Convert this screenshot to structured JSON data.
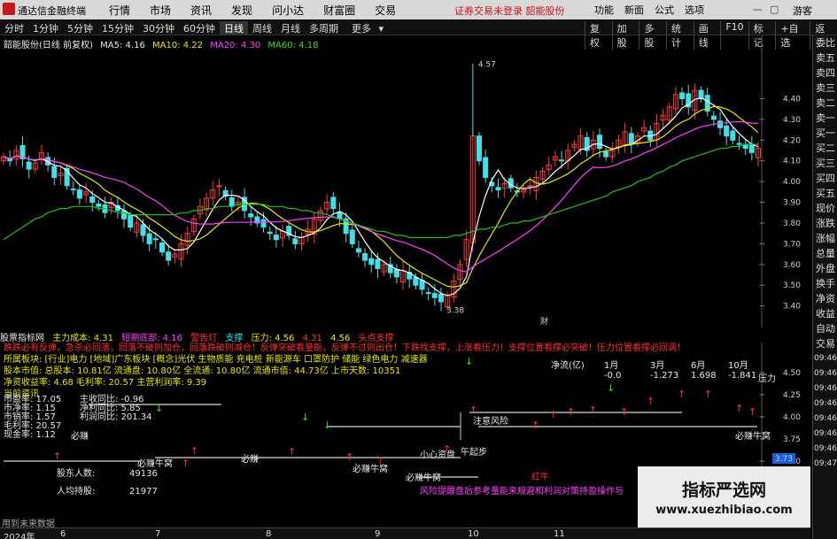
{
  "app": {
    "name": "通达信金融终端",
    "menu": [
      "行情",
      "市场",
      "资讯",
      "发现",
      "问小达",
      "财富圈",
      "交易"
    ],
    "warning": "证券交易未登录",
    "stock_title": "韶能股份",
    "right_menu": [
      "功能",
      "新面",
      "公式",
      "选项"
    ],
    "guest": "游客"
  },
  "toolbar": {
    "timeframes": [
      "分时",
      "1分钟",
      "5分钟",
      "15分钟",
      "30分钟",
      "60分钟",
      "日线",
      "周线",
      "月线",
      "多周期",
      "更多"
    ],
    "selected": "日线",
    "tools": [
      "复权",
      "加股",
      "多股",
      "统计",
      "画线",
      "F10",
      "标记",
      "+自选",
      "返回"
    ]
  },
  "main_legend": {
    "name": "韶能股份(日线 前复权)",
    "ma5": "MA5: 4.16",
    "ma10": "MA10: 4.22",
    "ma20": "MA20: 4.30",
    "ma60": "MA60: 4.18"
  },
  "colors": {
    "up": "#ff3b3b",
    "down": "#40e0e8",
    "ma5": "#ffffff",
    "ma10": "#e8e800",
    "ma20": "#ff40ff",
    "ma60": "#20c020"
  },
  "chart_data": {
    "type": "candlestick",
    "ylim": [
      3.36,
      4.62
    ],
    "y_ticks": [
      "4.40",
      "4.30",
      "4.20",
      "4.10",
      "4.00",
      "3.90",
      "3.80",
      "3.70",
      "3.60",
      "3.50",
      "3.40"
    ],
    "annotations": {
      "high": "4.57",
      "low": "3.38",
      "marker": "财"
    },
    "closes": [
      4.12,
      4.1,
      4.15,
      4.11,
      4.06,
      4.09,
      4.14,
      4.08,
      4.02,
      4.04,
      3.98,
      3.96,
      3.92,
      3.95,
      3.9,
      3.88,
      3.85,
      3.9,
      3.86,
      3.82,
      3.78,
      3.8,
      3.74,
      3.7,
      3.72,
      3.66,
      3.62,
      3.65,
      3.7,
      3.75,
      3.82,
      3.88,
      3.92,
      3.96,
      3.98,
      3.93,
      3.88,
      3.9,
      3.86,
      3.83,
      3.8,
      3.78,
      3.75,
      3.72,
      3.76,
      3.74,
      3.7,
      3.73,
      3.77,
      3.82,
      3.86,
      3.9,
      3.87,
      3.82,
      3.75,
      3.7,
      3.66,
      3.62,
      3.6,
      3.58,
      3.6,
      3.56,
      3.54,
      3.57,
      3.53,
      3.5,
      3.48,
      3.46,
      3.44,
      3.42,
      3.45,
      3.52,
      3.6,
      3.72,
      4.22,
      4.1,
      4.02,
      3.98,
      3.96,
      3.99,
      3.97,
      3.95,
      3.96,
      3.98,
      4.02,
      4.05,
      4.08,
      4.12,
      4.1,
      4.15,
      4.18,
      4.22,
      4.15,
      4.2,
      4.16,
      4.12,
      4.15,
      4.2,
      4.24,
      4.18,
      4.22,
      4.26,
      4.2,
      4.28,
      4.32,
      4.36,
      4.42,
      4.4,
      4.36,
      4.44,
      4.4,
      4.34,
      4.3,
      4.26,
      4.22,
      4.2,
      4.18,
      4.16,
      4.14,
      4.16
    ],
    "ma60": [
      3.72,
      3.74,
      3.76,
      3.78,
      3.8,
      3.82,
      3.83,
      3.85,
      3.86,
      3.87,
      3.87,
      3.88,
      3.88,
      3.88,
      3.88,
      3.87,
      3.87,
      3.86,
      3.85,
      3.85,
      3.84,
      3.84,
      3.84,
      3.84,
      3.84,
      3.84,
      3.84,
      3.84,
      3.85,
      3.85,
      3.86,
      3.86,
      3.87,
      3.87,
      3.88,
      3.88,
      3.88,
      3.89,
      3.89,
      3.89,
      3.89,
      3.89,
      3.88,
      3.88,
      3.88,
      3.87,
      3.87,
      3.86,
      3.86,
      3.85,
      3.85,
      3.84,
      3.83,
      3.82,
      3.81,
      3.8,
      3.79,
      3.78,
      3.77,
      3.76,
      3.76,
      3.75,
      3.74,
      3.74,
      3.73,
      3.73,
      3.73,
      3.73,
      3.73,
      3.73,
      3.73,
      3.74,
      3.74,
      3.75,
      3.76,
      3.77,
      3.77,
      3.78,
      3.78,
      3.79,
      3.8,
      3.8,
      3.81,
      3.81,
      3.82,
      3.83,
      3.84,
      3.85,
      3.86,
      3.87,
      3.88,
      3.89,
      3.9,
      3.91,
      3.92,
      3.93,
      3.95,
      3.96,
      3.97,
      3.98,
      4.0,
      4.01,
      4.02,
      4.04,
      4.05,
      4.07,
      4.08,
      4.1,
      4.11,
      4.12,
      4.13,
      4.14,
      4.15,
      4.16,
      4.16,
      4.17,
      4.17,
      4.18,
      4.18,
      4.18
    ]
  },
  "indicator": {
    "name": "股票指标网",
    "cost": "主力成本: 4.31",
    "bottom": "短期底部: 4.16",
    "alarm": "警告灯",
    "support": "支撑",
    "pressure": "压力: 4.56",
    "v1": "4.31",
    "v2": "4.56",
    "hint": "头点支撑",
    "alert_line": "跌跌必有反弹，急杀必回落，回落不破则加仓，回落跌破则减仓！反弹突破看量能，反弹不过则出仓！下跌找支撑，上涨看压力！支撑位置看撑必突破！压力位置看撑必回调！",
    "y_ticks": [
      "4.50",
      "4.25",
      "4.00",
      "3.75",
      "3.50"
    ],
    "last_price": "3.73"
  },
  "f10": {
    "sector": "所属板块: [行业]电力 [地域]广东板块 [概念]光伏 生物质能 充电桩 新能源车 口罩防护 储能 绿色电力 减速器",
    "shares": "股本市值: 总股本: 10.81亿  流通盘: 10.80亿  全流通: 10.80亿  流通市值: 44.73亿  上市天数: 10351",
    "profit": "净资收益率: 4.68  毛利率: 20.57  主营利润率: 9.39",
    "watch": "当前资讯"
  },
  "pe": {
    "pe": "市盈率: 17.05",
    "pb": "市净率: 1.15",
    "pe_ttm": "市销率: 1.57",
    "gross": "毛利率: 20.57",
    "cash": "现金率: 1.12",
    "growth": "主收同比: -0.96",
    "net_growth": "净利同比: 5.85",
    "eps": "利润同比: 201.34"
  },
  "holders": {
    "count_label": "股东人数:",
    "count_value": "49136",
    "avg_label": "人均持股:",
    "avg_value": "21977"
  },
  "netflow": {
    "label": "净流(亿)",
    "m1": "1月",
    "m3": "3月",
    "m6": "6月",
    "m10": "10月",
    "v1": "-0.0",
    "v3": "-1.273",
    "v6": "1.698",
    "v10": "-1.841",
    "pressure": "压力"
  },
  "signals": {
    "buy": "必赚",
    "hold": "必赚牛窝",
    "caution": "注意风险",
    "take": "午起步",
    "watch": "小心资盘",
    "red_bull": "红牛",
    "warn_bottom": "风险提醒盘后参考量能来规避和利润对策持盈操作与"
  },
  "bottom": {
    "hint": "用到未来数据",
    "year": "2024年",
    "months": [
      "6",
      "7",
      "8",
      "9",
      "10",
      "11"
    ]
  },
  "sidebar": [
    "委比",
    "卖五",
    "卖四",
    "卖三",
    "卖二",
    "卖一",
    "买一",
    "买二",
    "买三",
    "买四",
    "买五",
    "现价",
    "涨跌",
    "涨幅",
    "总量",
    "外盘",
    "换手",
    "净资",
    "收益",
    "自动",
    "交易"
  ],
  "sidebar_times": [
    "09:46",
    "09:46",
    "09:46",
    "09:46",
    "09:46",
    "09:46",
    "09:46",
    "09:47"
  ],
  "watermark": {
    "cn": "指标严选网",
    "en": "www.xuezhibiao.com"
  }
}
